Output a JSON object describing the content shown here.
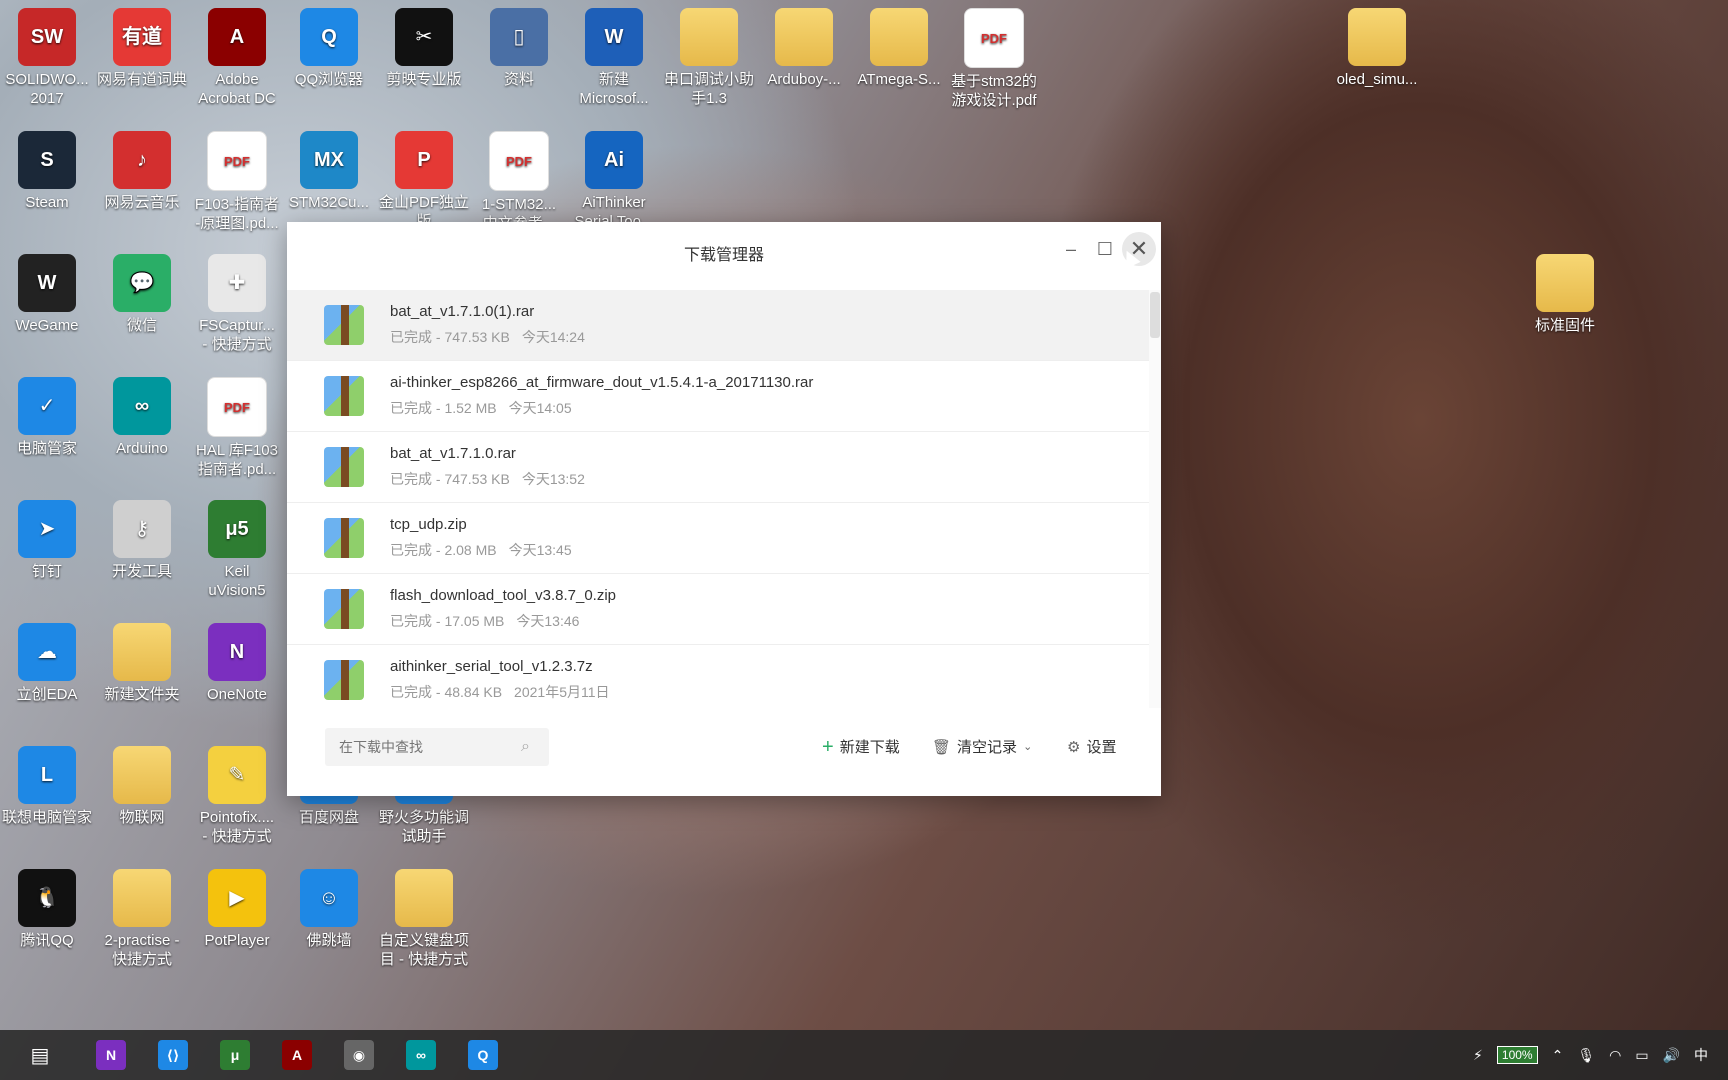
{
  "desktop": {
    "icons": [
      {
        "label": "SOLIDWO...\n2017",
        "icon": "solidworks-icon",
        "color": "#c62828",
        "glyph": "SW"
      },
      {
        "label": "网易有道词典",
        "icon": "youdao-icon",
        "color": "#e53935",
        "glyph": "有道"
      },
      {
        "label": "Adobe\nAcrobat DC",
        "icon": "acrobat-icon",
        "color": "#8b0000",
        "glyph": "A"
      },
      {
        "label": "QQ浏览器",
        "icon": "qq-browser-icon",
        "color": "#1e88e5",
        "glyph": "Q"
      },
      {
        "label": "剪映专业版",
        "icon": "jianying-icon",
        "color": "#111111",
        "glyph": "✂"
      },
      {
        "label": "资料",
        "icon": "phone-shortcut-icon",
        "color": "#4a6fa5",
        "glyph": "▯"
      },
      {
        "label": "新建\nMicrosof...",
        "icon": "word-doc-icon",
        "color": "#1e5fb8",
        "glyph": "W"
      },
      {
        "label": "串口调试小助\n手1.3",
        "icon": "folder-icon",
        "color": "#f2c94c",
        "glyph": ""
      },
      {
        "label": "Arduboy-...",
        "icon": "folder-icon",
        "color": "#f2c94c",
        "glyph": ""
      },
      {
        "label": "ATmega-S...",
        "icon": "folder-icon",
        "color": "#f2c94c",
        "glyph": ""
      },
      {
        "label": "基于stm32的\n游戏设计.pdf",
        "icon": "pdf-file-icon",
        "color": "#ffffff",
        "glyph": "PDF"
      },
      {
        "label": "oled_simu...",
        "icon": "folder-icon",
        "color": "#f2c94c",
        "glyph": ""
      },
      {
        "label": "Steam",
        "icon": "steam-icon",
        "color": "#1b2838",
        "glyph": "S"
      },
      {
        "label": "网易云音乐",
        "icon": "netease-music-icon",
        "color": "#d32f2f",
        "glyph": "♪"
      },
      {
        "label": "F103-指南者\n-原理图.pd...",
        "icon": "pdf-file-icon",
        "color": "#ffffff",
        "glyph": "PDF"
      },
      {
        "label": "STM32Cu...",
        "icon": "stm32cube-icon",
        "color": "#1e88c8",
        "glyph": "MX"
      },
      {
        "label": "金山PDF独立\n版",
        "icon": "kingsoft-pdf-icon",
        "color": "#e53935",
        "glyph": "P"
      },
      {
        "label": "1-STM32...\n中文参考...",
        "icon": "pdf-file-icon",
        "color": "#ffffff",
        "glyph": "PDF"
      },
      {
        "label": "AiThinker\nSerial Too...",
        "icon": "aithinker-icon",
        "color": "#1565c0",
        "glyph": "Ai"
      },
      {
        "label": "WeGame",
        "icon": "wegame-icon",
        "color": "#222222",
        "glyph": "W"
      },
      {
        "label": "微信",
        "icon": "wechat-icon",
        "color": "#2aae67",
        "glyph": "💬"
      },
      {
        "label": "FSCaptur...\n- 快捷方式",
        "icon": "fscapture-icon",
        "color": "#e8e8e8",
        "glyph": "✚"
      },
      {
        "label": "标准固件",
        "icon": "folder-icon",
        "color": "#f2c94c",
        "glyph": ""
      },
      {
        "label": "电脑管家",
        "icon": "pc-manager-icon",
        "color": "#1e88e5",
        "glyph": "✓"
      },
      {
        "label": "Arduino",
        "icon": "arduino-icon",
        "color": "#00979d",
        "glyph": "∞"
      },
      {
        "label": "HAL 库F103\n指南者.pd...",
        "icon": "pdf-file-icon",
        "color": "#ffffff",
        "glyph": "PDF"
      },
      {
        "label": "钉钉",
        "icon": "dingtalk-icon",
        "color": "#1e88e5",
        "glyph": "➤"
      },
      {
        "label": "开发工具",
        "icon": "dev-tools-icon",
        "color": "#cfcfcf",
        "glyph": "⚷"
      },
      {
        "label": "Keil\nuVision5",
        "icon": "keil-icon",
        "color": "#2e7d32",
        "glyph": "μ5"
      },
      {
        "label": "立创EDA",
        "icon": "lceda-icon",
        "color": "#1e88e5",
        "glyph": "☁"
      },
      {
        "label": "新建文件夹",
        "icon": "folder-icon",
        "color": "#f2c94c",
        "glyph": ""
      },
      {
        "label": "OneNote",
        "icon": "onenote-icon",
        "color": "#7b2fbf",
        "glyph": "N"
      },
      {
        "label": "联想电脑管家",
        "icon": "lenovo-manager-icon",
        "color": "#1e88e5",
        "glyph": "L"
      },
      {
        "label": "物联网",
        "icon": "folder-icon",
        "color": "#f2c94c",
        "glyph": ""
      },
      {
        "label": "Pointofix....\n- 快捷方式",
        "icon": "pointofix-icon",
        "color": "#f4d03f",
        "glyph": "✎"
      },
      {
        "label": "百度网盘",
        "icon": "baidu-netdisk-icon",
        "color": "#1e88e5",
        "glyph": ""
      },
      {
        "label": "野火多功能调\n试助手",
        "icon": "yehuo-tool-icon",
        "color": "#1e88e5",
        "glyph": ""
      },
      {
        "label": "腾讯QQ",
        "icon": "qq-icon",
        "color": "#111111",
        "glyph": "🐧"
      },
      {
        "label": "2-practise -\n快捷方式",
        "icon": "folder-icon",
        "color": "#f2c94c",
        "glyph": ""
      },
      {
        "label": "PotPlayer",
        "icon": "potplayer-icon",
        "color": "#f4c20d",
        "glyph": "▶"
      },
      {
        "label": "佛跳墙",
        "icon": "fotiaoqiang-icon",
        "color": "#1e88e5",
        "glyph": "☺"
      },
      {
        "label": "自定义键盘项\n目 - 快捷方式",
        "icon": "folder-icon",
        "color": "#f2c94c",
        "glyph": ""
      }
    ]
  },
  "window": {
    "title": "下载管理器",
    "minimize_glyph": "–",
    "maximize_glyph": "☐",
    "close_glyph": "✕",
    "downloads": [
      {
        "name": "bat_at_v1.7.1.0(1).rar",
        "status": "已完成",
        "size": "747.53 KB",
        "time": "今天14:24"
      },
      {
        "name": "ai-thinker_esp8266_at_firmware_dout_v1.5.4.1-a_20171130.rar",
        "status": "已完成",
        "size": "1.52 MB",
        "time": "今天14:05"
      },
      {
        "name": "bat_at_v1.7.1.0.rar",
        "status": "已完成",
        "size": "747.53 KB",
        "time": "今天13:52"
      },
      {
        "name": "tcp_udp.zip",
        "status": "已完成",
        "size": "2.08 MB",
        "time": "今天13:45"
      },
      {
        "name": "flash_download_tool_v3.8.7_0.zip",
        "status": "已完成",
        "size": "17.05 MB",
        "time": "今天13:46"
      },
      {
        "name": "aithinker_serial_tool_v1.2.3.7z",
        "status": "已完成",
        "size": "48.84 KB",
        "time": "2021年5月11日"
      }
    ],
    "search_placeholder": "在下载中查找",
    "new_download_label": "新建下载",
    "clear_records_label": "清空记录",
    "settings_label": "设置"
  },
  "taskbar": {
    "battery": "100%",
    "ime": "中",
    "apps": [
      "onenote-taskbar-icon",
      "vscode-taskbar-icon",
      "keil-taskbar-icon",
      "acrobat-taskbar-icon",
      "webcam-taskbar-icon",
      "arduino-taskbar-icon",
      "qq-browser-taskbar-icon"
    ]
  }
}
